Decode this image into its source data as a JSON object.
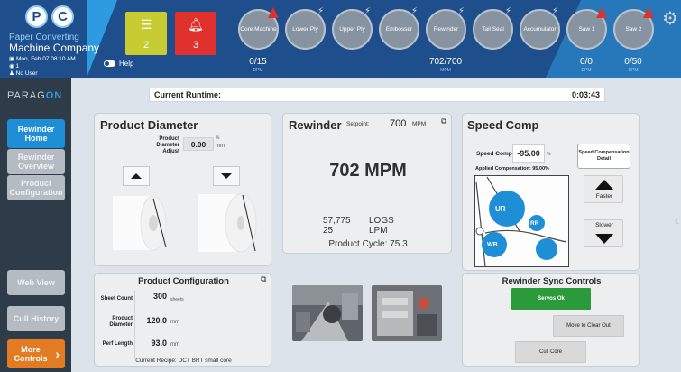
{
  "header": {
    "logo_letters": [
      "P",
      "C"
    ],
    "company_line1": "Paper Converting",
    "company_line2": "Machine Company",
    "datetime": "Mon, Feb 07 08:10 AM",
    "shift": "1",
    "user": "No User",
    "tiles": [
      {
        "icon": "list-check-icon",
        "value": "2",
        "color": "#c7cc33"
      },
      {
        "icon": "bell-icon",
        "value": "3",
        "color": "#e0312c"
      }
    ],
    "help_label": "Help",
    "machines": [
      {
        "label": "Core Machine",
        "alarm": true
      },
      {
        "label": "Lower Ply",
        "alarm": false
      },
      {
        "label": "Upper Ply",
        "alarm": false
      },
      {
        "label": "Embosser",
        "alarm": false
      },
      {
        "label": "Rewinder",
        "alarm": false
      },
      {
        "label": "Tail Seal",
        "alarm": false
      },
      {
        "label": "Accumulator",
        "alarm": false
      },
      {
        "label": "Saw 1",
        "alarm": true
      },
      {
        "label": "Saw 2",
        "alarm": true
      }
    ],
    "counters": [
      {
        "value": "0/15",
        "unit": "DPM"
      },
      {
        "value": "702/700",
        "unit": "MPM"
      },
      {
        "value": "0/0",
        "unit": "DPM"
      },
      {
        "value": "0/50",
        "unit": "DPM"
      }
    ]
  },
  "sidebar": {
    "brand_left": "PARAG",
    "brand_right": "ON",
    "items": [
      {
        "label": "Rewinder Home",
        "state": "active"
      },
      {
        "label": "Rewinder Overview",
        "state": "normal"
      },
      {
        "label": "Product Configuration",
        "state": "normal"
      },
      {
        "label": "Web View",
        "state": "normal"
      },
      {
        "label": "Cull History",
        "state": "normal"
      },
      {
        "label": "More Controls",
        "state": "more"
      }
    ]
  },
  "runtime": {
    "label": "Current Runtime:",
    "value": "0:03:43"
  },
  "product_diameter": {
    "title": "Product Diameter",
    "adjust_label": "Product Diameter Adjust",
    "adjust_value": "0.00",
    "adjust_unit": "mm",
    "adjust_unit_small": "%"
  },
  "rewinder": {
    "title": "Rewinder",
    "setpoint_label": "Setpoint:",
    "setpoint_value": "700",
    "setpoint_unit": "MPM",
    "speed": "702 MPM",
    "logs_value": "57,775",
    "logs_label": "LOGS",
    "lpm_value": "25",
    "lpm_label": "LPM",
    "cycle": "Product Cycle: 75.3"
  },
  "speed_comp": {
    "title": "Speed Comp",
    "comp_label": "Speed Comp",
    "comp_value": "-95.00",
    "comp_unit": "%",
    "applied": "Applied Compensation: 95.00%",
    "detail_button": "Speed Compensation Detail",
    "faster": "Faster",
    "slower": "Slower",
    "rolls": [
      "UR",
      "RR",
      "WB"
    ]
  },
  "product_config": {
    "title": "Product Configuration",
    "rows": [
      {
        "label": "Sheet Count",
        "value": "300",
        "unit": "sheets"
      },
      {
        "label": "Product Diameter",
        "value": "120.0",
        "unit": "mm"
      },
      {
        "label": "Perf Length",
        "value": "93.0",
        "unit": "mm"
      }
    ],
    "recipe": "Current Recipe: DCT BRT small core"
  },
  "sync": {
    "title": "Rewinder Sync Controls",
    "servos": "Servos Ok",
    "clear_out": "Move to Clear Out",
    "cull_core": "Cull Core"
  },
  "colors": {
    "header_bg": "#1e4f8c",
    "accent": "#2e9be0",
    "active_nav": "#1e8fd6",
    "more_controls": "#e27b22",
    "servos_ok": "#2b9a3b",
    "alarm": "#e0312c"
  }
}
